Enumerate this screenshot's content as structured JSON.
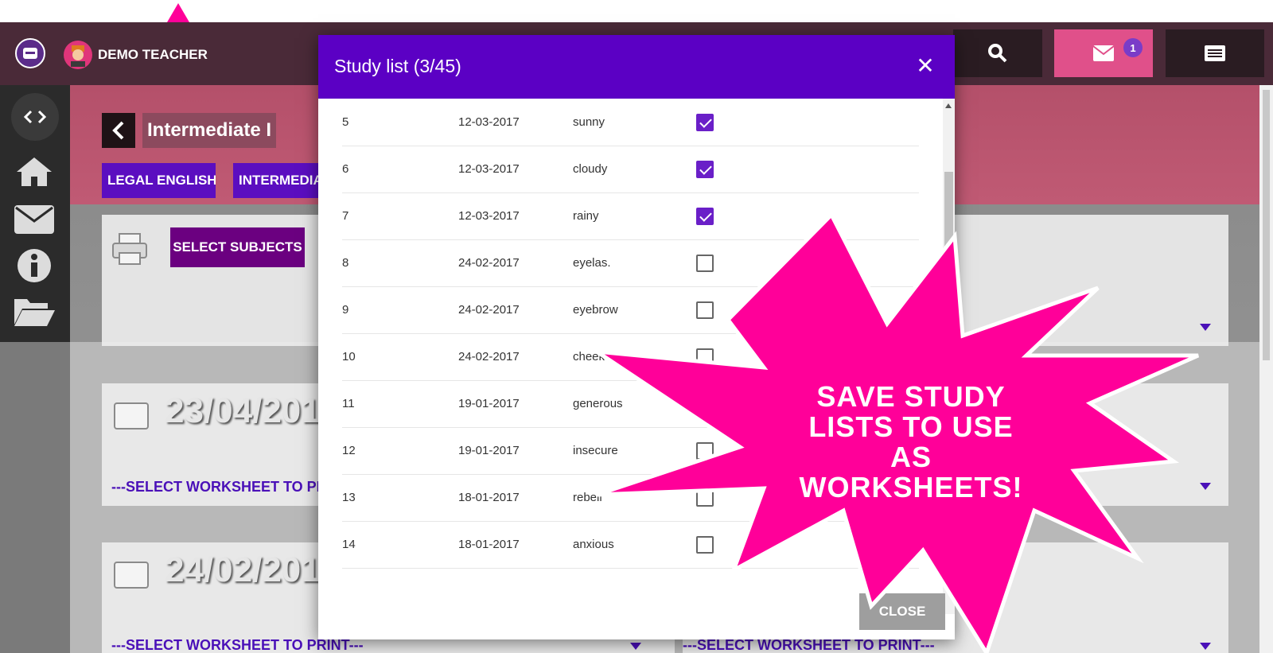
{
  "header": {
    "teacher_name": "DEMO TEACHER",
    "mail_badge": "1",
    "icons": [
      "logo-icon",
      "avatar-icon",
      "search-icon",
      "mail-icon",
      "list-icon"
    ]
  },
  "sidebar": {
    "items": [
      "code-icon",
      "home-icon",
      "mail-icon",
      "info-icon",
      "folder-open-icon"
    ]
  },
  "page": {
    "course_title": "Intermediate I",
    "tags": [
      "LEGAL ENGLISH",
      "INTERMEDIA"
    ],
    "select_subjects": "SELECT SUBJECTS",
    "worksheets": [
      {
        "date": "23/04/201",
        "select_label": "---SELECT WORKSHEET TO PRI"
      },
      {
        "date": "24/02/201",
        "select_label": "---SELECT WORKSHEET TO PRINT---"
      }
    ],
    "right_select_label": "---SELECT WORKSHEET TO PRINT---"
  },
  "modal": {
    "title": "Study list (3/45)",
    "close_label": "CLOSE",
    "rows": [
      {
        "num": "5",
        "date": "12-03-2017",
        "word": "sunny",
        "checked": true
      },
      {
        "num": "6",
        "date": "12-03-2017",
        "word": "cloudy",
        "checked": true
      },
      {
        "num": "7",
        "date": "12-03-2017",
        "word": "rainy",
        "checked": true
      },
      {
        "num": "8",
        "date": "24-02-2017",
        "word": "eyelas.",
        "checked": false
      },
      {
        "num": "9",
        "date": "24-02-2017",
        "word": "eyebrow",
        "checked": false
      },
      {
        "num": "10",
        "date": "24-02-2017",
        "word": "cheek",
        "checked": false
      },
      {
        "num": "11",
        "date": "19-01-2017",
        "word": "generous",
        "checked": false
      },
      {
        "num": "12",
        "date": "19-01-2017",
        "word": "insecure",
        "checked": false
      },
      {
        "num": "13",
        "date": "18-01-2017",
        "word": "rebell",
        "checked": false
      },
      {
        "num": "14",
        "date": "18-01-2017",
        "word": "anxious",
        "checked": false
      }
    ]
  },
  "promo": {
    "line1": "SAVE STUDY",
    "line2": "LISTS TO USE AS",
    "line3": "WORKSHEETS!",
    "color": "#ff0099"
  },
  "colors": {
    "header_bg": "#4a2a38",
    "modal_header": "#5b00c4",
    "accent_purple": "#5b0ec0",
    "mail_button": "#e0508a"
  }
}
